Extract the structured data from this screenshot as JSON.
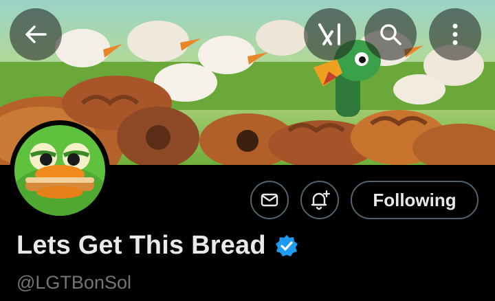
{
  "header": {
    "back_icon": "arrow-left-icon",
    "grok_icon": "grok-icon",
    "search_icon": "search-icon",
    "more_icon": "more-vertical-icon",
    "banner": "bread-and-ducks-illustration"
  },
  "profile": {
    "display_name": "Lets Get This Bread",
    "handle": "@LGTBonSol",
    "verified": true,
    "avatar": "duck-with-bread-avatar"
  },
  "actions": {
    "message_icon": "envelope-icon",
    "notify_icon": "bell-plus-icon",
    "follow_label": "Following"
  },
  "colors": {
    "background": "#000000",
    "text": "#e7e9ea",
    "secondary_text": "#71767b",
    "border": "#536471",
    "verified": "#1d9bf0"
  }
}
